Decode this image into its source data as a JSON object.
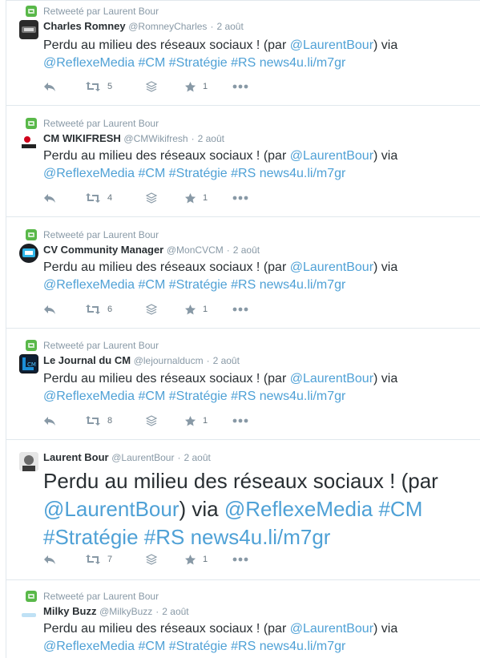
{
  "retweet_label": "Retweeté par Laurent Bour",
  "tweet_body": {
    "lead": "Perdu au milieu des réseaux sociaux ! (par ",
    "mention_author": "@LaurentBour",
    "mid": ") via ",
    "mention_source": "@ReflexeMedia",
    "tag_cm": "#CM",
    "tag_strategie": "#Stratégie",
    "tag_rs": "#RS",
    "link": "news4u.li/m7gr"
  },
  "tweets": [
    {
      "retweeted": true,
      "name": "Charles Romney",
      "handle": "@RomneyCharles",
      "time": "2 août",
      "retweets": "5",
      "favorites": "1",
      "avatar_color": "#2a2a2a"
    },
    {
      "retweeted": true,
      "name": "CM WIKIFRESH",
      "handle": "@CMWikifresh",
      "time": "2 août",
      "retweets": "4",
      "favorites": "1",
      "avatar_color": "#d0021b"
    },
    {
      "retweeted": true,
      "name": "CV Community Manager",
      "handle": "@MonCVCM",
      "time": "2 août",
      "retweets": "6",
      "favorites": "1",
      "avatar_color": "#1b1f24"
    },
    {
      "retweeted": true,
      "name": "Le Journal du CM",
      "handle": "@lejournalducm",
      "time": "2 août",
      "retweets": "8",
      "favorites": "1",
      "avatar_color": "#1c8fd8"
    },
    {
      "retweeted": false,
      "name": "Laurent Bour",
      "handle": "@LaurentBour",
      "time": "2 août",
      "retweets": "7",
      "favorites": "1",
      "avatar_color": "#5a5a5a"
    },
    {
      "retweeted": true,
      "name": "Milky Buzz",
      "handle": "@MilkyBuzz",
      "time": "2 août",
      "retweets": "",
      "favorites": "",
      "avatar_color": "#bfe1f5"
    }
  ],
  "icons": {
    "retweet_badge": "retweet-badge-icon",
    "reply": "reply-icon",
    "retweet": "retweet-icon",
    "buffer": "buffer-stack-icon",
    "favorite": "favorite-star-icon",
    "more": "more-dots-icon"
  },
  "colors": {
    "link": "#4fa1d6",
    "retweet_green": "#59b849",
    "muted": "#8899a6"
  }
}
